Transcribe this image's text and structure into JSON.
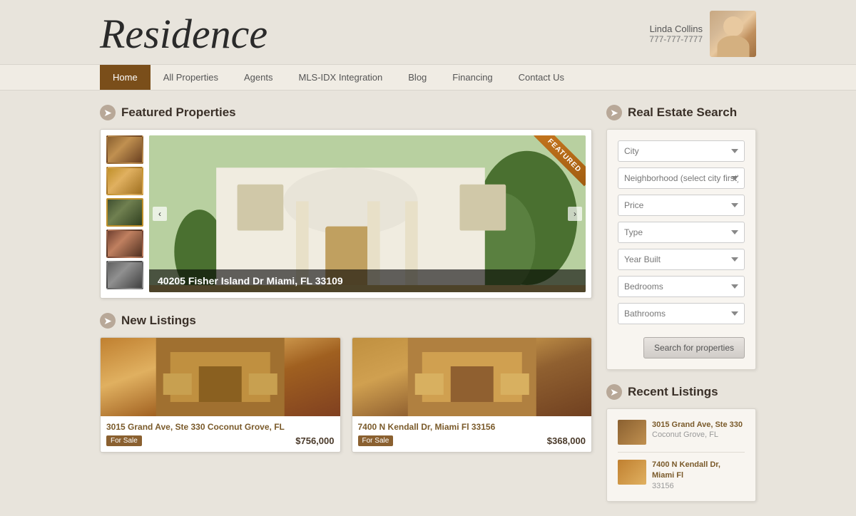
{
  "header": {
    "logo": "Residence",
    "agent": {
      "name": "Linda Collins",
      "phone": "777-777-7777"
    }
  },
  "nav": {
    "items": [
      {
        "label": "Home",
        "active": true
      },
      {
        "label": "All Properties",
        "active": false
      },
      {
        "label": "Agents",
        "active": false
      },
      {
        "label": "MLS-IDX Integration",
        "active": false
      },
      {
        "label": "Blog",
        "active": false
      },
      {
        "label": "Financing",
        "active": false
      },
      {
        "label": "Contact Us",
        "active": false
      }
    ]
  },
  "featured": {
    "section_title": "Featured Properties",
    "ribbon_text": "FEATURED",
    "address": "40205 Fisher Island Dr Miami, FL 33109"
  },
  "new_listings": {
    "section_title": "New Listings",
    "items": [
      {
        "address": "3015 Grand Ave, Ste 330 Coconut Grove, FL",
        "status": "For Sale",
        "price": "$756,000"
      },
      {
        "address": "7400 N Kendall Dr, Miami Fl 33156",
        "status": "For Sale",
        "price": "$368,000"
      }
    ]
  },
  "search": {
    "section_title": "Real Estate Search",
    "fields": [
      {
        "placeholder": "City",
        "id": "city"
      },
      {
        "placeholder": "Neighborhood (select city first)",
        "id": "neighborhood"
      },
      {
        "placeholder": "Price",
        "id": "price"
      },
      {
        "placeholder": "Type",
        "id": "type"
      },
      {
        "placeholder": "Year Built",
        "id": "year_built"
      },
      {
        "placeholder": "Bedrooms",
        "id": "bedrooms"
      },
      {
        "placeholder": "Bathrooms",
        "id": "bathrooms"
      }
    ],
    "button_label": "Search for properties"
  },
  "recent_listings": {
    "section_title": "Recent Listings",
    "items": [
      {
        "address": "3015 Grand Ave, Ste 330",
        "city": "Coconut Grove, FL"
      },
      {
        "address": "7400 N Kendall Dr, Miami Fl",
        "city": "33156"
      }
    ]
  }
}
